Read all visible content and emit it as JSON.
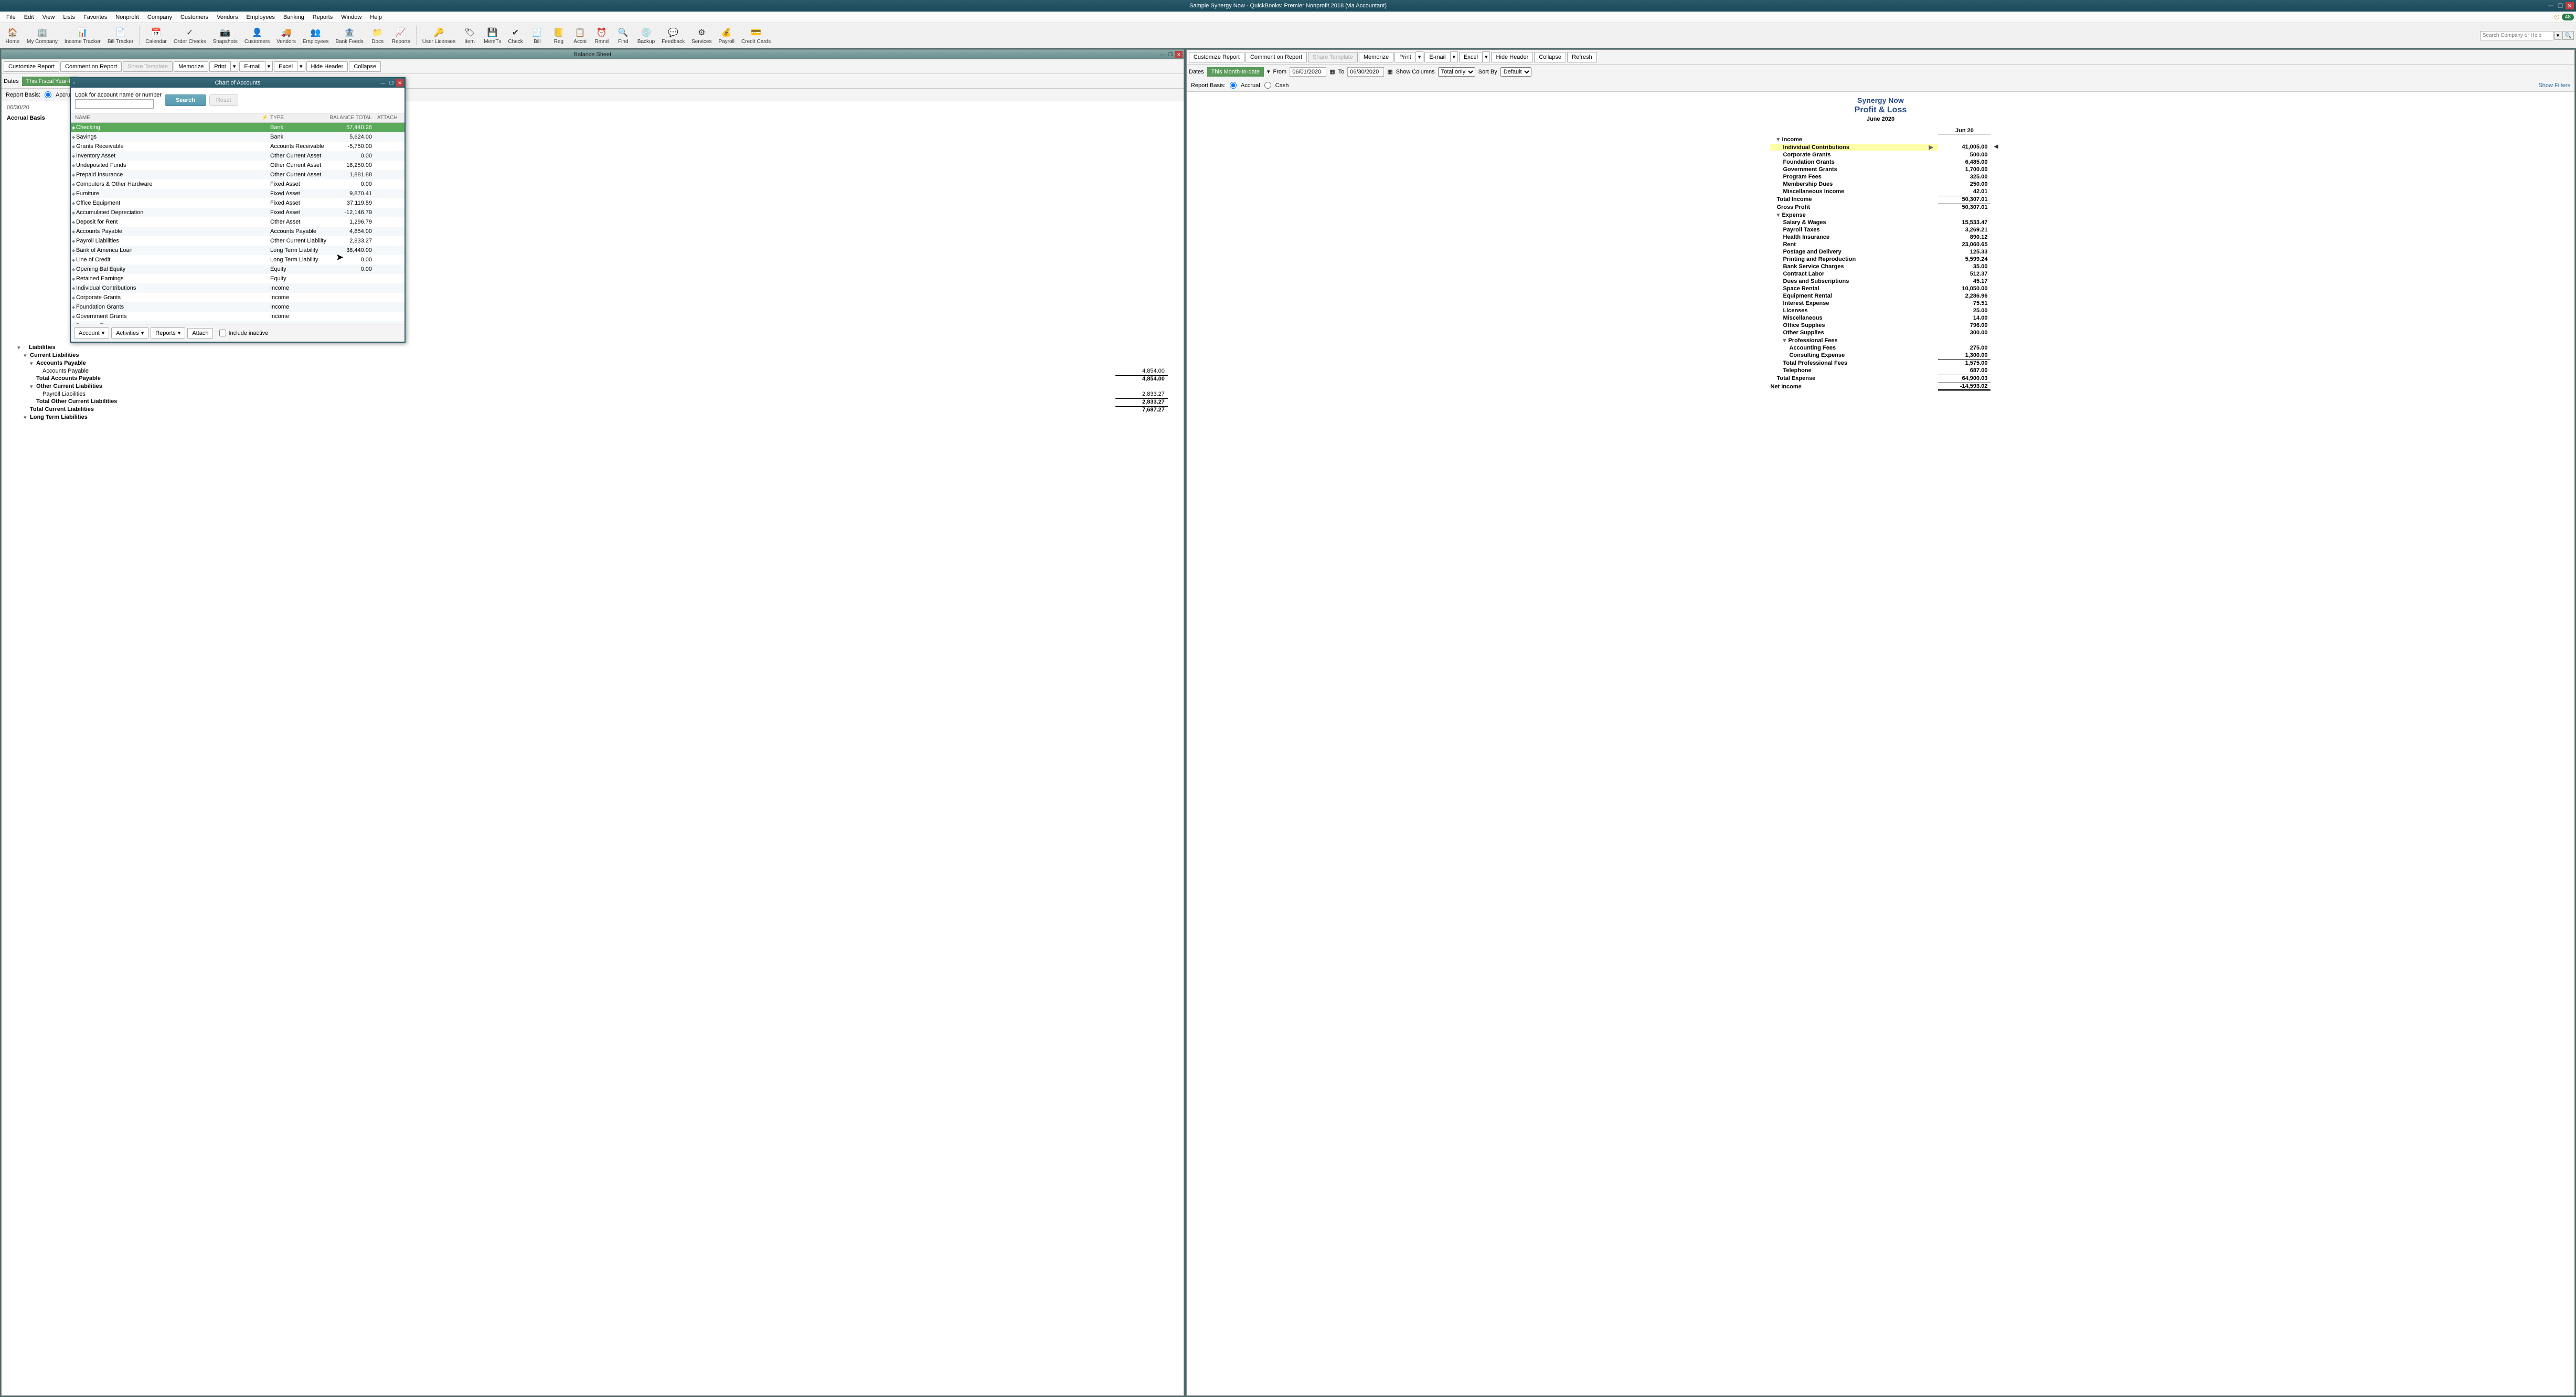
{
  "titlebar": "Sample Synergy Now  -  QuickBooks: Premier Nonprofit 2018 (via Accountant)",
  "menubar": [
    "File",
    "Edit",
    "View",
    "Lists",
    "Favorites",
    "Nonprofit",
    "Company",
    "Customers",
    "Vendors",
    "Employees",
    "Banking",
    "Reports",
    "Window",
    "Help"
  ],
  "reminders_badge": "48",
  "toolbar": [
    {
      "label": "Home",
      "icon": "home"
    },
    {
      "label": "My Company",
      "icon": "company"
    },
    {
      "label": "Income Tracker",
      "icon": "income"
    },
    {
      "label": "Bill Tracker",
      "icon": "bill"
    },
    {
      "label": "Calendar",
      "icon": "calendar"
    },
    {
      "label": "Order Checks",
      "icon": "checks"
    },
    {
      "label": "Snapshots",
      "icon": "snapshot"
    },
    {
      "label": "Customers",
      "icon": "customers"
    },
    {
      "label": "Vendors",
      "icon": "vendors"
    },
    {
      "label": "Employees",
      "icon": "employees"
    },
    {
      "label": "Bank Feeds",
      "icon": "bank"
    },
    {
      "label": "Docs",
      "icon": "docs"
    },
    {
      "label": "Reports",
      "icon": "reports"
    },
    {
      "label": "User Licenses",
      "icon": "users"
    },
    {
      "label": "Item",
      "icon": "item"
    },
    {
      "label": "MemTx",
      "icon": "memtx"
    },
    {
      "label": "Check",
      "icon": "check"
    },
    {
      "label": "Bill",
      "icon": "bill2"
    },
    {
      "label": "Reg",
      "icon": "reg"
    },
    {
      "label": "Accnt",
      "icon": "accnt"
    },
    {
      "label": "Rmnd",
      "icon": "rmnd"
    },
    {
      "label": "Find",
      "icon": "find"
    },
    {
      "label": "Backup",
      "icon": "backup"
    },
    {
      "label": "Feedback",
      "icon": "feedback"
    },
    {
      "label": "Services",
      "icon": "services"
    },
    {
      "label": "Payroll",
      "icon": "payroll"
    },
    {
      "label": "Credit Cards",
      "icon": "cc"
    }
  ],
  "search_placeholder": "Search Company or Help",
  "balance_sheet": {
    "title": "Balance Sheet",
    "toolbar": [
      "Customize Report",
      "Comment on Report",
      "Share Template",
      "Memorize",
      "Print",
      "E-mail",
      "Excel",
      "Hide Header",
      "Collapse"
    ],
    "dates_label": "Dates",
    "dates_value": "This Fiscal Year-to",
    "report_basis_label": "Report Basis:",
    "basis_accrual": "Accrual",
    "date_stamp": "06/30/20",
    "basis_text": "Accrual Basis",
    "partial": {
      "liabilities": "Liabilities",
      "current_liabilities": "Current Liabilities",
      "accounts_payable_h": "Accounts Payable",
      "accounts_payable": "Accounts Payable",
      "accounts_payable_v": "4,854.00",
      "total_ap": "Total Accounts Payable",
      "total_ap_v": "4,854.00",
      "other_cl": "Other Current Liabilities",
      "payroll_liab": "Payroll Liabilities",
      "payroll_liab_v": "2,833.27",
      "total_ocl": "Total Other Current Liabilities",
      "total_ocl_v": "2,833.27",
      "total_cl": "Total Current Liabilities",
      "total_cl_v": "7,687.27",
      "ltl": "Long Term Liabilities"
    }
  },
  "coa": {
    "title": "Chart of Accounts",
    "search_label": "Look for account name or number",
    "search_btn": "Search",
    "reset_btn": "Reset",
    "columns": {
      "name": "NAME",
      "type": "TYPE",
      "balance": "BALANCE TOTAL",
      "attach": "ATTACH"
    },
    "rows": [
      {
        "name": "Checking",
        "type": "Bank",
        "bal": "57,440.26",
        "selected": true
      },
      {
        "name": "Savings",
        "type": "Bank",
        "bal": "5,624.00"
      },
      {
        "name": "Grants Receivable",
        "type": "Accounts Receivable",
        "bal": "-5,750.00"
      },
      {
        "name": "Inventory Asset",
        "type": "Other Current Asset",
        "bal": "0.00"
      },
      {
        "name": "Undeposited Funds",
        "type": "Other Current Asset",
        "bal": "18,250.00"
      },
      {
        "name": "Prepaid Insurance",
        "type": "Other Current Asset",
        "bal": "1,881.88"
      },
      {
        "name": "Computers & Other Hardware",
        "type": "Fixed Asset",
        "bal": "0.00"
      },
      {
        "name": "Furniture",
        "type": "Fixed Asset",
        "bal": "9,870.41"
      },
      {
        "name": "Office Equipment",
        "type": "Fixed Asset",
        "bal": "37,119.59"
      },
      {
        "name": "Accumulated Depreciation",
        "type": "Fixed Asset",
        "bal": "-12,146.79"
      },
      {
        "name": "Deposit for Rent",
        "type": "Other Asset",
        "bal": "1,296.79"
      },
      {
        "name": "Accounts Payable",
        "type": "Accounts Payable",
        "bal": "4,854.00"
      },
      {
        "name": "Payroll Liabilities",
        "type": "Other Current Liability",
        "bal": "2,833.27"
      },
      {
        "name": "Bank of America Loan",
        "type": "Long Term Liability",
        "bal": "38,440.00"
      },
      {
        "name": "Line of Credit",
        "type": "Long Term Liability",
        "bal": "0.00"
      },
      {
        "name": "Opening Bal Equity",
        "type": "Equity",
        "bal": "0.00"
      },
      {
        "name": "Retained Earnings",
        "type": "Equity",
        "bal": ""
      },
      {
        "name": "Individual Contributions",
        "type": "Income",
        "bal": ""
      },
      {
        "name": "Corporate Grants",
        "type": "Income",
        "bal": ""
      },
      {
        "name": "Foundation Grants",
        "type": "Income",
        "bal": ""
      },
      {
        "name": "Government Grants",
        "type": "Income",
        "bal": ""
      },
      {
        "name": "Program Fees",
        "type": "Income",
        "bal": ""
      }
    ],
    "footer": {
      "account": "Account",
      "activities": "Activities",
      "reports": "Reports",
      "attach": "Attach",
      "include_inactive": "Include inactive"
    }
  },
  "pl": {
    "title": "Profit & Loss",
    "toolbar": [
      "Customize Report",
      "Comment on Report",
      "Share Template",
      "Memorize",
      "Print",
      "E-mail",
      "Excel",
      "Hide Header",
      "Collapse",
      "Refresh"
    ],
    "dates_label": "Dates",
    "dates_value": "This Month-to-date",
    "from_label": "From",
    "from_value": "06/01/2020",
    "to_label": "To",
    "to_value": "06/30/2020",
    "show_cols_label": "Show Columns",
    "show_cols_value": "Total only",
    "sort_by_label": "Sort By",
    "sort_by_value": "Default",
    "report_basis_label": "Report Basis:",
    "accrual": "Accrual",
    "cash": "Cash",
    "show_filters": "Show Filters",
    "company": "Synergy Now",
    "report_name": "Profit & Loss",
    "period": "June 2020",
    "col_header": "Jun 20",
    "rows": [
      {
        "name": "Income",
        "indent": 1,
        "bold": true,
        "tri": true
      },
      {
        "name": "Individual Contributions",
        "val": "41,005.00",
        "indent": 2,
        "bold": true,
        "expand": true,
        "drill": true
      },
      {
        "name": "Corporate Grants",
        "val": "500.00",
        "indent": 2,
        "bold": true
      },
      {
        "name": "Foundation Grants",
        "val": "6,485.00",
        "indent": 2,
        "bold": true
      },
      {
        "name": "Government Grants",
        "val": "1,700.00",
        "indent": 2,
        "bold": true
      },
      {
        "name": "Program Fees",
        "val": "325.00",
        "indent": 2,
        "bold": true
      },
      {
        "name": "Membership Dues",
        "val": "250.00",
        "indent": 2,
        "bold": true
      },
      {
        "name": "Miscellaneous Income",
        "val": "42.01",
        "indent": 2,
        "bold": true
      },
      {
        "name": "Total Income",
        "val": "50,307.01",
        "indent": 1,
        "bold": true,
        "underline": true
      },
      {
        "name": "Gross Profit",
        "val": "50,307.01",
        "indent": 1,
        "bold": true,
        "underline": true
      },
      {
        "name": "Expense",
        "indent": 1,
        "bold": true,
        "tri": true
      },
      {
        "name": "Salary & Wages",
        "val": "15,533.47",
        "indent": 2,
        "bold": true
      },
      {
        "name": "Payroll Taxes",
        "val": "3,269.21",
        "indent": 2,
        "bold": true
      },
      {
        "name": "Health Insurance",
        "val": "890.12",
        "indent": 2,
        "bold": true
      },
      {
        "name": "Rent",
        "val": "23,060.65",
        "indent": 2,
        "bold": true
      },
      {
        "name": "Postage and Delivery",
        "val": "125.33",
        "indent": 2,
        "bold": true
      },
      {
        "name": "Printing and Reproduction",
        "val": "5,599.24",
        "indent": 2,
        "bold": true
      },
      {
        "name": "Bank Service Charges",
        "val": "35.00",
        "indent": 2,
        "bold": true
      },
      {
        "name": "Contract Labor",
        "val": "512.37",
        "indent": 2,
        "bold": true
      },
      {
        "name": "Dues and Subscriptions",
        "val": "45.17",
        "indent": 2,
        "bold": true
      },
      {
        "name": "Space Rental",
        "val": "10,050.00",
        "indent": 2,
        "bold": true
      },
      {
        "name": "Equipment Rental",
        "val": "2,286.96",
        "indent": 2,
        "bold": true
      },
      {
        "name": "Interest Expense",
        "val": "75.51",
        "indent": 2,
        "bold": true
      },
      {
        "name": "Licenses",
        "val": "25.00",
        "indent": 2,
        "bold": true
      },
      {
        "name": "Miscellaneous",
        "val": "14.00",
        "indent": 2,
        "bold": true
      },
      {
        "name": "Office Supplies",
        "val": "796.00",
        "indent": 2,
        "bold": true
      },
      {
        "name": "Other Supplies",
        "val": "300.00",
        "indent": 2,
        "bold": true
      },
      {
        "name": "Professional Fees",
        "indent": 2,
        "bold": true,
        "tri": true
      },
      {
        "name": "Accounting Fees",
        "val": "275.00",
        "indent": 3,
        "bold": true
      },
      {
        "name": "Consulting Expense",
        "val": "1,300.00",
        "indent": 3,
        "bold": true
      },
      {
        "name": "Total Professional Fees",
        "val": "1,575.00",
        "indent": 2,
        "bold": true,
        "underline": true
      },
      {
        "name": "Telephone",
        "val": "687.00",
        "indent": 2,
        "bold": true
      },
      {
        "name": "Total Expense",
        "val": "64,900.03",
        "indent": 1,
        "bold": true,
        "underline": true
      },
      {
        "name": "Net Income",
        "val": "-14,593.02",
        "indent": 0,
        "bold": true,
        "underline": true,
        "double": true
      }
    ]
  }
}
